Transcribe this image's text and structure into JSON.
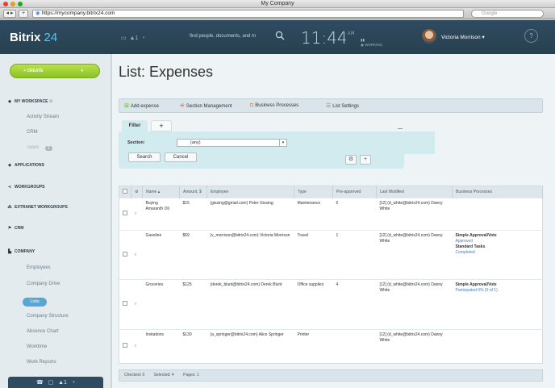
{
  "window": {
    "title": "My Company"
  },
  "browser": {
    "url": "https://mycompany.bitrix24.com",
    "search_placeholder": "Google"
  },
  "header": {
    "logo_text": "Bitrix",
    "logo_num": "24",
    "search_text": "find people, documents, and m",
    "clock": "11:44",
    "clock_ampm": "AM",
    "working_status": "WORKING",
    "user_name": "Victoria Morrison",
    "help": "?"
  },
  "sidebar": {
    "create_label": "CREATE",
    "my_workspace": "MY WORKSPACE",
    "items_ws": [
      "Activity Stream",
      "CRM",
      "Tasks"
    ],
    "tasks_count": "1",
    "applications": "APPLICATIONS",
    "workgroups": "WORKGROUPS",
    "extranet": "EXTRANET WORKGROUPS",
    "crm": "CRM",
    "company": "COMPANY",
    "company_items": [
      "Employees",
      "Company Drive",
      "Company Structure",
      "Absence Chart",
      "Worktime",
      "Work Reports"
    ],
    "lists_pill": "Lists"
  },
  "main": {
    "title": "List: Expenses",
    "actions": [
      "Add expense",
      "Section Management",
      "Business Processes",
      "List Settings"
    ],
    "filter": {
      "tab": "Filter",
      "plus": "+",
      "section_label": "Section:",
      "section_value": "(any)",
      "search_btn": "Search",
      "cancel_btn": "Cancel"
    },
    "columns": [
      "Name",
      "Amount, $",
      "Employee",
      "Type",
      "Pre-approved",
      "Last Modified",
      "Business Processes"
    ],
    "rows": [
      {
        "name": "Buying Amaranth Oil",
        "amount": "$15",
        "employee": "(gissing@gmail.com) Peter Gissing",
        "type": "Maintenance",
        "preapproved": "6",
        "modified": "[12] (d_white@bitrix24.com) Danny White",
        "bp_title": "",
        "bp_status": "",
        "bp_title2": "",
        "bp_status2": ""
      },
      {
        "name": "Gasoline",
        "amount": "$59",
        "employee": "(v_morrison@bitrix24.com) Victoria Morrison",
        "type": "Travel",
        "preapproved": "1",
        "modified": "[12] (d_white@bitrix24.com) Danny White",
        "bp_title": "Simple Approval/Vote",
        "bp_status": "Approved",
        "bp_title2": "Standard Tasks",
        "bp_status2": "Completed"
      },
      {
        "name": "Groceries",
        "amount": "$125",
        "employee": "(derek_blunt@bitrix24.com) Derek Blunt",
        "type": "Office supplies",
        "preapproved": "4",
        "modified": "[12] (d_white@bitrix24.com) Danny White",
        "bp_title": "Simple Approval/Vote",
        "bp_status": "Participated 0% (0 of 1)",
        "bp_title2": "",
        "bp_status2": ""
      },
      {
        "name": "Invitations",
        "amount": "$130",
        "employee": "(a_springer@bitrix24.com) Alice Springer",
        "type": "Printer",
        "preapproved": "",
        "modified": "[12] (d_white@bitrix24.com) Danny White",
        "bp_title": "",
        "bp_status": "",
        "bp_title2": "",
        "bp_status2": ""
      }
    ],
    "footer": {
      "checked": "Checked: 0",
      "selected": "Selected: 4",
      "pages": "Pages: 1"
    }
  }
}
